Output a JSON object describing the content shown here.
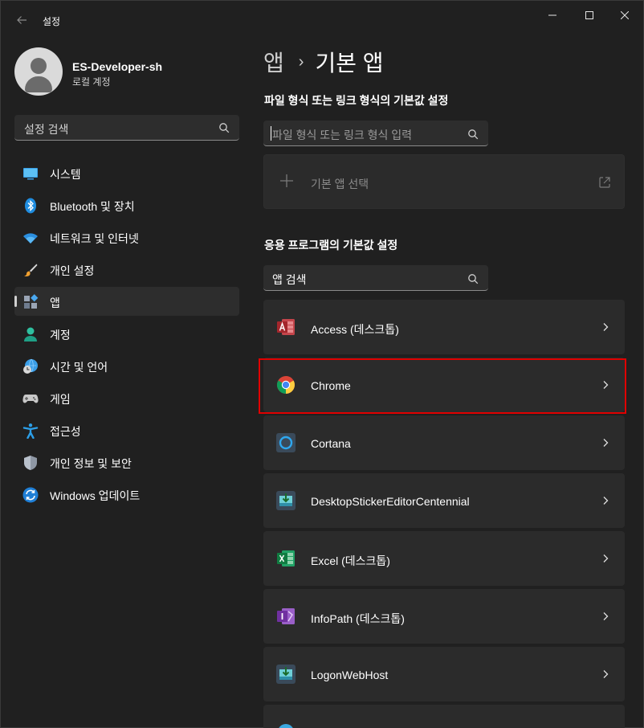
{
  "window": {
    "title": "설정",
    "back_icon": "back-arrow-icon",
    "controls": [
      "minimize-icon",
      "maximize-icon",
      "close-icon"
    ]
  },
  "profile": {
    "name": "ES-Developer-sh",
    "account_type": "로컬 계정"
  },
  "sidebar": {
    "search_placeholder": "설정 검색",
    "items": [
      {
        "label": "시스템",
        "icon": "monitor-icon",
        "selected": false
      },
      {
        "label": "Bluetooth 및 장치",
        "icon": "bluetooth-icon",
        "selected": false
      },
      {
        "label": "네트워크 및 인터넷",
        "icon": "wifi-icon",
        "selected": false
      },
      {
        "label": "개인 설정",
        "icon": "brush-icon",
        "selected": false
      },
      {
        "label": "앱",
        "icon": "apps-icon",
        "selected": true
      },
      {
        "label": "계정",
        "icon": "person-icon",
        "selected": false
      },
      {
        "label": "시간 및 언어",
        "icon": "globe-clock-icon",
        "selected": false
      },
      {
        "label": "게임",
        "icon": "gamepad-icon",
        "selected": false
      },
      {
        "label": "접근성",
        "icon": "accessibility-icon",
        "selected": false
      },
      {
        "label": "개인 정보 및 보안",
        "icon": "shield-icon",
        "selected": false
      },
      {
        "label": "Windows 업데이트",
        "icon": "update-icon",
        "selected": false
      }
    ]
  },
  "breadcrumb": {
    "parent": "앱",
    "separator": "›",
    "current": "기본 앱"
  },
  "file_type_section": {
    "title": "파일 형식 또는 링크 형식의 기본값 설정",
    "input_placeholder": "파일 형식 또는 링크 형식 입력",
    "default_app_label": "기본 앱 선택"
  },
  "apps_section": {
    "title": "응용 프로그램의 기본값 설정",
    "search_value": "앱 검색",
    "apps": [
      {
        "name": "Access (데스크톱)",
        "icon": "access-icon"
      },
      {
        "name": "Chrome",
        "icon": "chrome-icon"
      },
      {
        "name": "Cortana",
        "icon": "cortana-icon"
      },
      {
        "name": "DesktopStickerEditorCentennial",
        "icon": "installer-icon"
      },
      {
        "name": "Excel (데스크톱)",
        "icon": "excel-icon"
      },
      {
        "name": "InfoPath (데스크톱)",
        "icon": "infopath-icon"
      },
      {
        "name": "LogonWebHost",
        "icon": "installer-icon"
      }
    ]
  },
  "colors": {
    "background": "#202020",
    "card": "#2b2b2b",
    "highlight": "#e00000"
  }
}
